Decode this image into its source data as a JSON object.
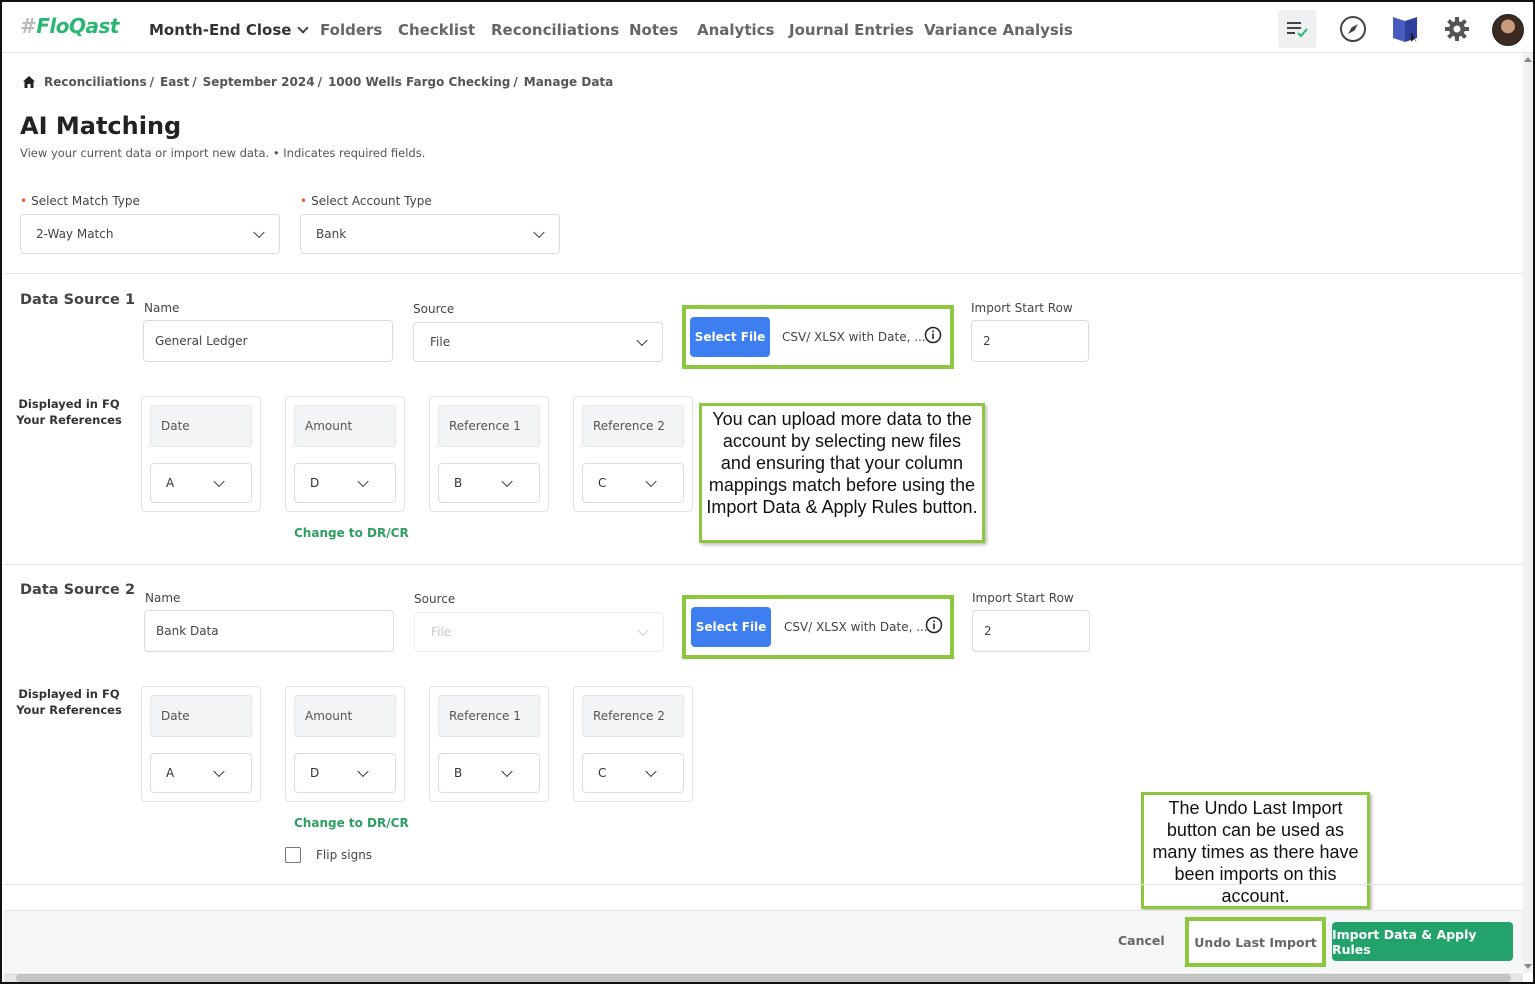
{
  "nav": {
    "logo_hash": "#",
    "logo_text": "FloQast",
    "primary": "Month-End Close",
    "items": [
      "Folders",
      "Checklist",
      "Reconciliations",
      "Notes",
      "Analytics",
      "Journal Entries",
      "Variance Analysis"
    ]
  },
  "breadcrumb": [
    "Reconciliations",
    "East",
    "September 2024",
    "1000 Wells Fargo Checking",
    "Manage Data"
  ],
  "breadcrumb_sep": "/",
  "page": {
    "title": "AI Matching",
    "subtitle": "View your current data or import new data. • Indicates required fields."
  },
  "match": {
    "required_mark": "•",
    "type_label": "Select Match Type",
    "type_value": "2-Way Match",
    "account_label": "Select Account Type",
    "account_value": "Bank"
  },
  "labels": {
    "name": "Name",
    "source": "Source",
    "import_start_row": "Import Start Row",
    "displayed_line1": "Displayed in FQ",
    "displayed_line2": "Your References",
    "select_file": "Select File",
    "file_hint": "CSV/ XLSX with Date, ...",
    "change_drcr": "Change to DR/CR"
  },
  "sources": [
    {
      "title": "Data Source 1",
      "name": "General Ledger",
      "source": "File",
      "start_row": "2",
      "columns": [
        {
          "header": "Date",
          "col": "A"
        },
        {
          "header": "Amount",
          "col": "D"
        },
        {
          "header": "Reference 1",
          "col": "B"
        },
        {
          "header": "Reference 2",
          "col": "C"
        }
      ]
    },
    {
      "title": "Data Source 2",
      "name": "Bank Data",
      "source": "File",
      "start_row": "2",
      "flip_signs": "Flip signs",
      "columns": [
        {
          "header": "Date",
          "col": "A"
        },
        {
          "header": "Amount",
          "col": "D"
        },
        {
          "header": "Reference 1",
          "col": "B"
        },
        {
          "header": "Reference 2",
          "col": "C"
        }
      ]
    }
  ],
  "callouts": {
    "upload": "You can upload more data to the account by selecting new files and ensuring that your column mappings match before using the Import Data & Apply Rules button.",
    "undo": "The Undo Last Import button can be used as many times as there have been imports on this account."
  },
  "footer": {
    "cancel": "Cancel",
    "undo": "Undo Last Import",
    "import": "Import Data & Apply Rules"
  },
  "colors": {
    "brand_green": "#2bb673",
    "primary_blue": "#3d7ef0",
    "action_green": "#23a36b",
    "highlight_green": "#8dc63f"
  },
  "icons": [
    "home-icon",
    "task-list-icon",
    "compass-icon",
    "book-icon",
    "gear-icon",
    "info-icon",
    "chevron-down-icon"
  ]
}
